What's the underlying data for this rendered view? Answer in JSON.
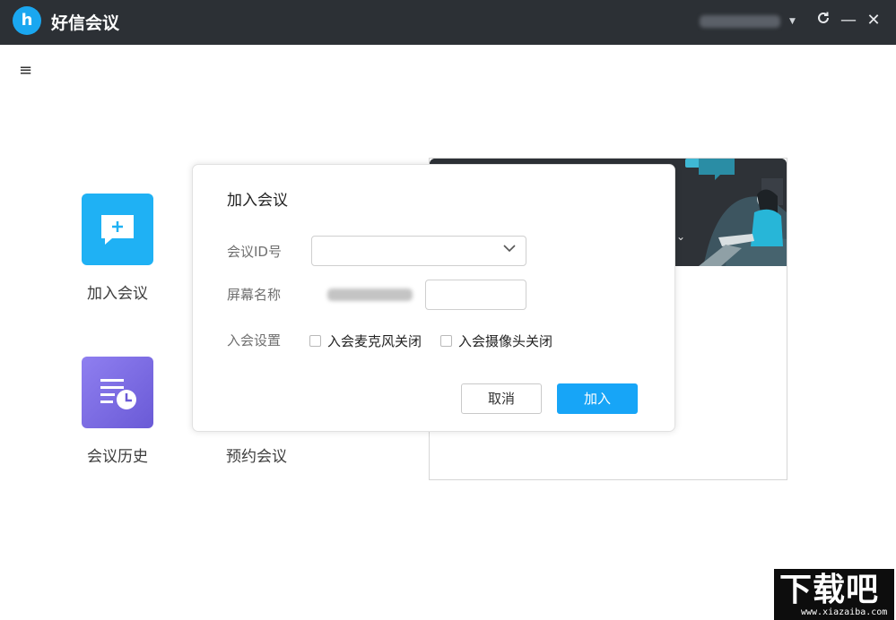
{
  "titlebar": {
    "app_title": "好信会议",
    "logo_letter": "h",
    "user_caret": "▼",
    "refresh_symbol": "C",
    "minimize_symbol": "—",
    "close_symbol": "✕"
  },
  "nav": {
    "menu_symbol": "≡"
  },
  "tiles": {
    "join_label": "加入会议",
    "history_label": "会议历史",
    "schedule_label": "预约会议"
  },
  "side_panel": {
    "caret": "⌄"
  },
  "dialog": {
    "title": "加入会议",
    "meeting_id_label": "会议ID号",
    "meeting_id_value": "",
    "meeting_id_dropdown": "﹀",
    "screen_name_label": "屏幕名称",
    "screen_name_value": "",
    "settings_label": "入会设置",
    "mic_off_label": "入会麦克风关闭",
    "mic_off_checked": false,
    "camera_off_label": "入会摄像头关闭",
    "camera_off_checked": false,
    "cancel_label": "取消",
    "join_label": "加入"
  },
  "watermark": {
    "brand": "下载吧",
    "url": "www.xiazaiba.com"
  },
  "colors": {
    "titlebar_bg": "#2c3035",
    "accent_blue": "#17a5f7",
    "join_tile": "#1fb1f4",
    "history_tile": "#7b6ae4"
  }
}
